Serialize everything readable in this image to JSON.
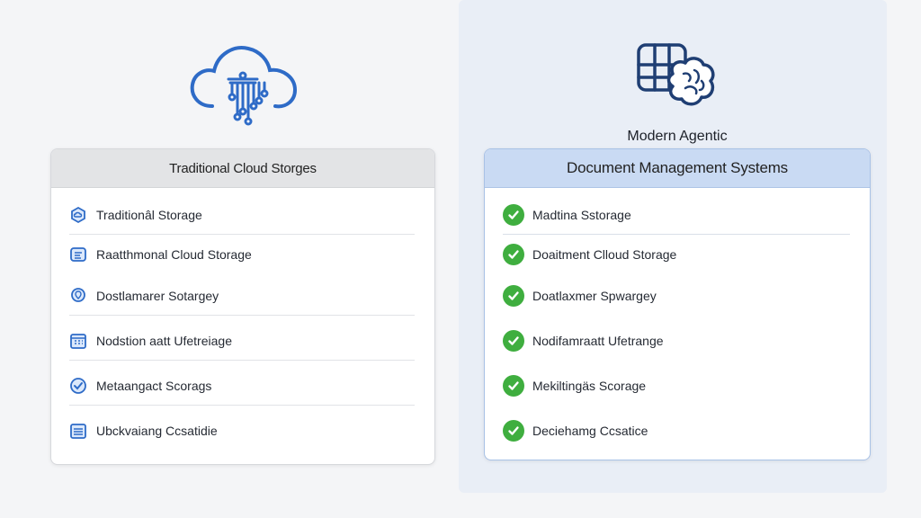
{
  "left": {
    "header": "Traditional Cloud Storges",
    "items": [
      {
        "label": "Traditionâl Storage",
        "icon": "cloud-box-icon"
      },
      {
        "label": "Raatthmonal Cloud Storage",
        "icon": "folder-icon"
      },
      {
        "label": "Dostlamarer Sotargey",
        "icon": "pin-icon"
      },
      {
        "label": "Nodstion aatt Ufetreiage",
        "icon": "calendar-icon"
      },
      {
        "label": "Metaangact Scorags",
        "icon": "shield-check-icon"
      },
      {
        "label": "Ubckvaiang Ccsatidie",
        "icon": "list-icon"
      }
    ]
  },
  "right": {
    "title": "Modern Agentic",
    "header": "Document Management Systems",
    "items": [
      {
        "label": "Madtina Sstorage"
      },
      {
        "label": "Doaitment Clloud Storage"
      },
      {
        "label": "Doatlaxmer Spwargey"
      },
      {
        "label": "Nodifamraatt Ufetrange"
      },
      {
        "label": "Mekiltingäs Scorage"
      },
      {
        "label": "Deciehamg Ccsatice"
      }
    ]
  },
  "colors": {
    "accent_blue": "#2e6bc7",
    "check_green": "#3fae3f",
    "right_header_bg": "#c9daf3",
    "left_header_bg": "#e3e4e6"
  }
}
